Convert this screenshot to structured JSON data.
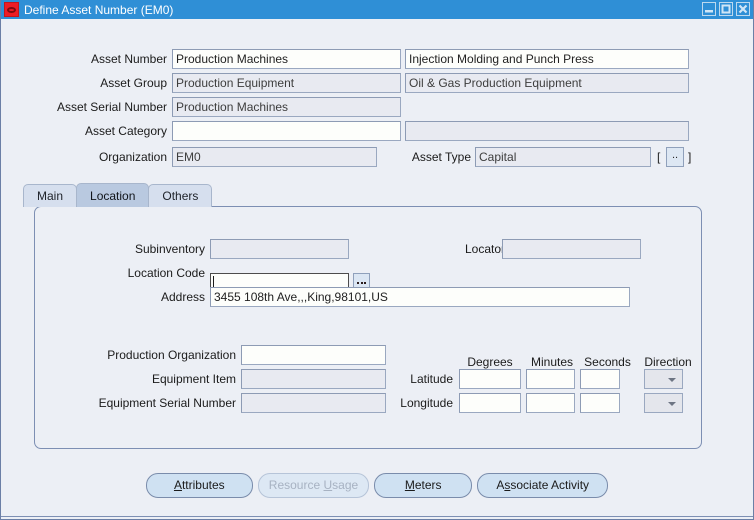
{
  "window": {
    "title": "Define Asset Number (EM0)",
    "logo_icon": "oracle-logo-icon",
    "controls": [
      {
        "name": "minimize-button",
        "icon": "minimize-icon"
      },
      {
        "name": "maximize-button",
        "icon": "maximize-icon"
      },
      {
        "name": "close-button",
        "icon": "close-icon"
      }
    ],
    "titlebar_color": "#2f8fd6",
    "background_color": "#eceff5"
  },
  "header": {
    "fields": [
      {
        "label": "Asset Number",
        "value": "Production Machines",
        "editable": true,
        "value2": "Injection Molding and Punch Press",
        "editable2": true
      },
      {
        "label": "Asset Group",
        "value": "Production Equipment",
        "editable": false,
        "value2": "Oil & Gas Production Equipment",
        "editable2": false
      },
      {
        "label": "Asset Serial Number",
        "value": "Production Machines",
        "editable": false,
        "value2": "",
        "editable2": false
      },
      {
        "label": "Asset Category",
        "value": "",
        "editable": true,
        "value2": "",
        "editable2": false
      },
      {
        "label": "Organization",
        "value": "EM0",
        "editable": false
      }
    ],
    "asset_type_label": "Asset Type",
    "asset_type_value": "Capital",
    "flex_bracket_open": "[",
    "flex_bracket_close": "]",
    "flex_button_label": "..",
    "flex_button_name": "descriptive-flexfield-button"
  },
  "tabs": [
    {
      "label": "Main",
      "active": false
    },
    {
      "label": "Location",
      "active": true
    },
    {
      "label": "Others",
      "active": false
    }
  ],
  "location_tab": {
    "subinventory_label": "Subinventory",
    "subinventory_value": "",
    "locator_label": "Locator",
    "locator_value": "",
    "location_code_label": "Location Code",
    "location_code_value": "",
    "location_code_lov_icon": "ellipsis-lov-icon",
    "address_label": "Address",
    "address_value": "3455 108th Ave,,,King,98101,US",
    "production_org_label": "Production Organization",
    "production_org_value": "",
    "equipment_item_label": "Equipment Item",
    "equipment_item_value": "",
    "equipment_serial_label": "Equipment Serial Number",
    "equipment_serial_value": "",
    "coord_headers": [
      "Degrees",
      "Minutes",
      "Seconds",
      "Direction"
    ],
    "latitude_label": "Latitude",
    "longitude_label": "Longitude",
    "latitude": {
      "degrees": "",
      "minutes": "",
      "seconds": "",
      "direction": ""
    },
    "longitude": {
      "degrees": "",
      "minutes": "",
      "seconds": "",
      "direction": ""
    }
  },
  "footer": {
    "buttons": [
      {
        "label": "Attributes",
        "name": "attributes-button",
        "disabled": false,
        "mnemonic": "A"
      },
      {
        "label": "Resource Usage",
        "name": "resource-usage-button",
        "disabled": true,
        "mnemonic": "U"
      },
      {
        "label": "Meters",
        "name": "meters-button",
        "disabled": false,
        "mnemonic": "M"
      },
      {
        "label": "Associate Activity",
        "name": "associate-activity-button",
        "disabled": false,
        "mnemonic": "s"
      }
    ]
  }
}
